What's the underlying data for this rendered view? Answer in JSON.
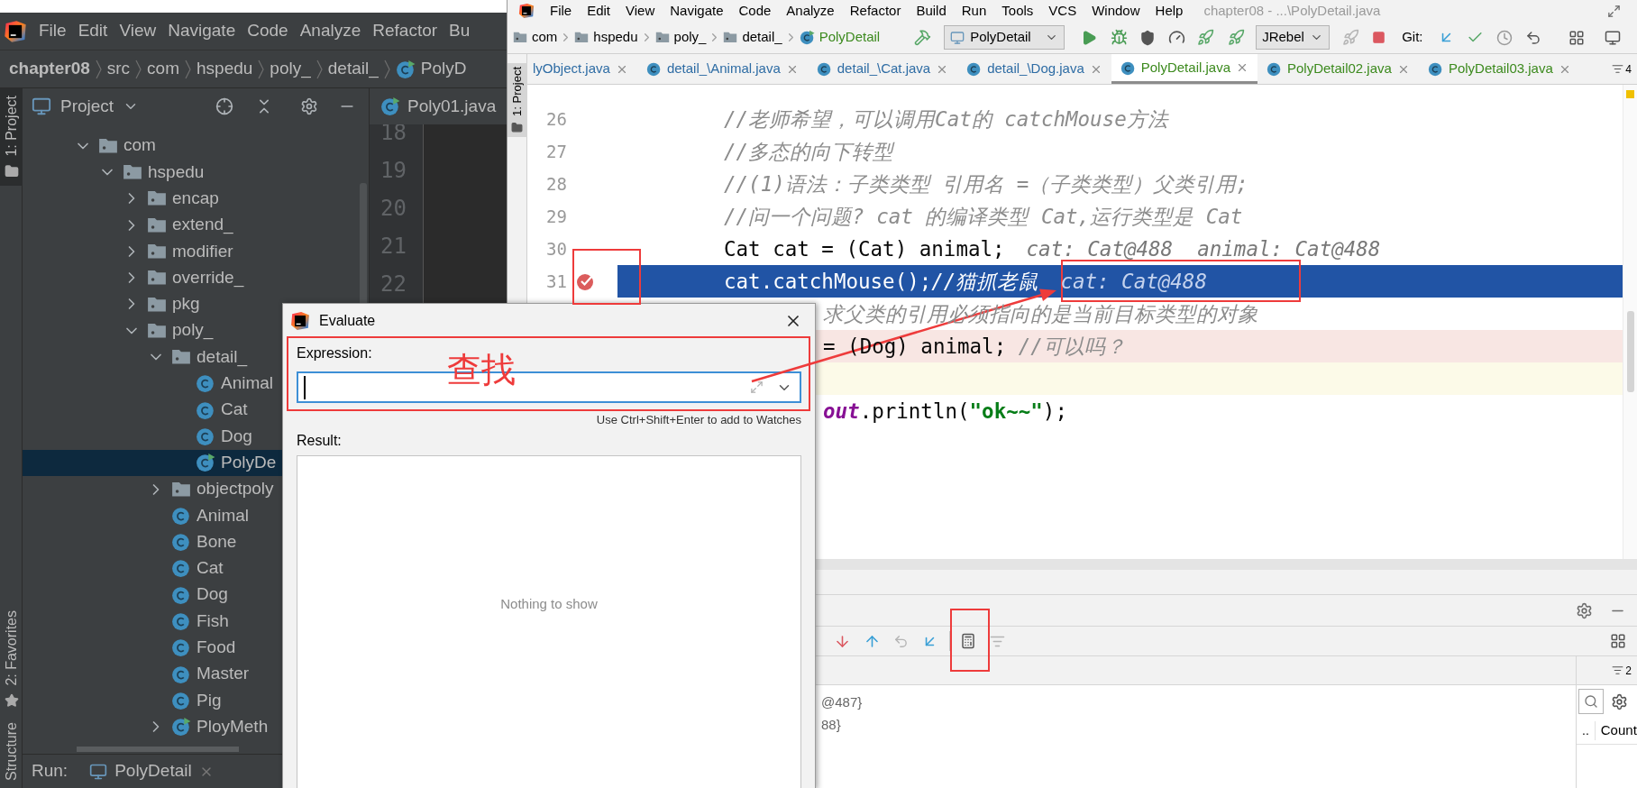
{
  "left_window": {
    "menu": [
      "File",
      "Edit",
      "View",
      "Navigate",
      "Code",
      "Analyze",
      "Refactor",
      "Bu"
    ],
    "breadcrumb": [
      "chapter08",
      "src",
      "com",
      "hspedu",
      "poly_",
      "detail_",
      "PolyD"
    ],
    "tool_tabs": [
      {
        "label": "1: Project",
        "selected": true
      },
      {
        "label": "2: Favorites",
        "selected": false
      },
      {
        "label": "Structure",
        "selected": false
      }
    ],
    "project_panel": {
      "title": "Project",
      "tree": [
        {
          "label": "com",
          "kind": "folder",
          "expanded": true,
          "selected": false,
          "children": [
            {
              "label": "hspedu",
              "kind": "folder",
              "expanded": true,
              "selected": false,
              "children": [
                {
                  "label": "encap",
                  "kind": "folder",
                  "expanded": false,
                  "selected": false
                },
                {
                  "label": "extend_",
                  "kind": "folder",
                  "expanded": false,
                  "selected": false
                },
                {
                  "label": "modifier",
                  "kind": "folder",
                  "expanded": false,
                  "selected": false
                },
                {
                  "label": "override_",
                  "kind": "folder",
                  "expanded": false,
                  "selected": false
                },
                {
                  "label": "pkg",
                  "kind": "folder",
                  "expanded": false,
                  "selected": false
                },
                {
                  "label": "poly_",
                  "kind": "folder",
                  "expanded": true,
                  "selected": false,
                  "children": [
                    {
                      "label": "detail_",
                      "kind": "folder",
                      "expanded": true,
                      "selected": false,
                      "children": [
                        {
                          "label": "Animal",
                          "kind": "class",
                          "selected": false
                        },
                        {
                          "label": "Cat",
                          "kind": "class",
                          "selected": false
                        },
                        {
                          "label": "Dog",
                          "kind": "class",
                          "selected": false
                        },
                        {
                          "label": "PolyDe",
                          "kind": "main_class",
                          "selected": true
                        }
                      ]
                    },
                    {
                      "label": "objectpoly",
                      "kind": "folder",
                      "expanded": false,
                      "selected": false
                    },
                    {
                      "label": "Animal",
                      "kind": "class",
                      "selected": false
                    },
                    {
                      "label": "Bone",
                      "kind": "class",
                      "selected": false
                    },
                    {
                      "label": "Cat",
                      "kind": "class",
                      "selected": false
                    },
                    {
                      "label": "Dog",
                      "kind": "class",
                      "selected": false
                    },
                    {
                      "label": "Fish",
                      "kind": "class",
                      "selected": false
                    },
                    {
                      "label": "Food",
                      "kind": "class",
                      "selected": false
                    },
                    {
                      "label": "Master",
                      "kind": "class",
                      "selected": false
                    },
                    {
                      "label": "Pig",
                      "kind": "class",
                      "selected": false
                    },
                    {
                      "label": "PloyMeth",
                      "kind": "main_class",
                      "expanded": false,
                      "selected": false
                    }
                  ]
                }
              ]
            }
          ]
        }
      ]
    },
    "editor": {
      "tab": "Poly01.java",
      "line_numbers": [
        "18",
        "19",
        "20",
        "21",
        "22"
      ]
    },
    "run_bar": {
      "label": "Run:",
      "tab": "PolyDetail"
    }
  },
  "right_window": {
    "menu": [
      "File",
      "Edit",
      "View",
      "Navigate",
      "Code",
      "Analyze",
      "Refactor",
      "Build",
      "Run",
      "Tools",
      "VCS",
      "Window",
      "Help"
    ],
    "title": "chapter08 - ...\\PolyDetail.java",
    "breadcrumb": [
      "com",
      "hspedu",
      "poly_",
      "detail_",
      "PolyDetail"
    ],
    "run_config": "PolyDetail",
    "plugin_config": "JRebel",
    "git_label": "Git:",
    "tool_tab": "1: Project",
    "tabs": [
      {
        "label": "lyObject.java",
        "selected": false,
        "color": "#2e6ca4"
      },
      {
        "label": "detail_\\Animal.java",
        "selected": false,
        "color": "#2e6ca4"
      },
      {
        "label": "detail_\\Cat.java",
        "selected": false,
        "color": "#2e6ca4"
      },
      {
        "label": "detail_\\Dog.java",
        "selected": false,
        "color": "#2e6ca4"
      },
      {
        "label": "PolyDetail.java",
        "selected": true,
        "color": "#3c8a1e"
      },
      {
        "label": "PolyDetail02.java",
        "selected": false,
        "color": "#3c8a1e"
      },
      {
        "label": "PolyDetail03.java",
        "selected": false,
        "color": "#3c8a1e"
      }
    ],
    "tab_count": "4",
    "code_lines": [
      {
        "number": "26",
        "breakpoint": false,
        "kind": "plain",
        "segments": [
          {
            "kind": "comment",
            "text": "//老师希望，可以调用Cat的 catchMouse方法"
          }
        ]
      },
      {
        "number": "27",
        "breakpoint": false,
        "kind": "plain",
        "segments": [
          {
            "kind": "comment",
            "text": "//多态的向下转型"
          }
        ]
      },
      {
        "number": "28",
        "breakpoint": false,
        "kind": "plain",
        "segments": [
          {
            "kind": "comment",
            "text": "//(1)语法：子类类型 引用名 =（子类类型）父类引用;"
          }
        ]
      },
      {
        "number": "29",
        "breakpoint": false,
        "kind": "plain",
        "segments": [
          {
            "kind": "comment",
            "text": "//问一个问题? cat 的编译类型 Cat,运行类型是 Cat"
          }
        ]
      },
      {
        "number": "30",
        "breakpoint": false,
        "kind": "plain",
        "segments": [
          {
            "kind": "code",
            "text": "Cat cat = (Cat) animal;"
          },
          {
            "kind": "hint",
            "text": "cat: Cat@488  animal: Cat@488"
          }
        ]
      },
      {
        "number": "31",
        "breakpoint": true,
        "kind": "execution",
        "segments": [
          {
            "kind": "code",
            "text": "cat.catchMouse();"
          },
          {
            "kind": "comment",
            "text": "//猫抓老鼠"
          },
          {
            "kind": "hint",
            "text": "cat: Cat@488"
          }
        ]
      },
      {
        "kind": "plain",
        "segments": [
          {
            "kind": "comment",
            "text": "求父类的引用必须指向的是当前目标类型的对象"
          }
        ]
      },
      {
        "kind": "error",
        "segments": [
          {
            "kind": "code",
            "text": "= (Dog) animal; "
          },
          {
            "kind": "comment",
            "text": "//可以吗？"
          }
        ]
      },
      {
        "kind": "caret"
      },
      {
        "kind": "plain",
        "segments": [
          {
            "kind": "field",
            "text": "out"
          },
          {
            "kind": "code",
            "text": ".println("
          },
          {
            "kind": "string",
            "text": "\"ok~~\""
          },
          {
            "kind": "code",
            "text": ");"
          }
        ]
      }
    ],
    "debugger": {
      "frames_count": "2",
      "variables": [
        "@487}",
        "88}"
      ],
      "side_columns": [
        "..",
        "Count"
      ]
    }
  },
  "evaluate_dialog": {
    "title": "Evaluate",
    "expression_label": "Expression:",
    "hint": "Use Ctrl+Shift+Enter to add to Watches",
    "result_label": "Result:",
    "result_empty": "Nothing to show"
  },
  "annotations": [
    {
      "kind": "box"
    },
    {
      "kind": "box"
    },
    {
      "kind": "box"
    },
    {
      "kind": "box"
    },
    {
      "kind": "arrow"
    },
    {
      "kind": "label",
      "text": "查找"
    }
  ]
}
